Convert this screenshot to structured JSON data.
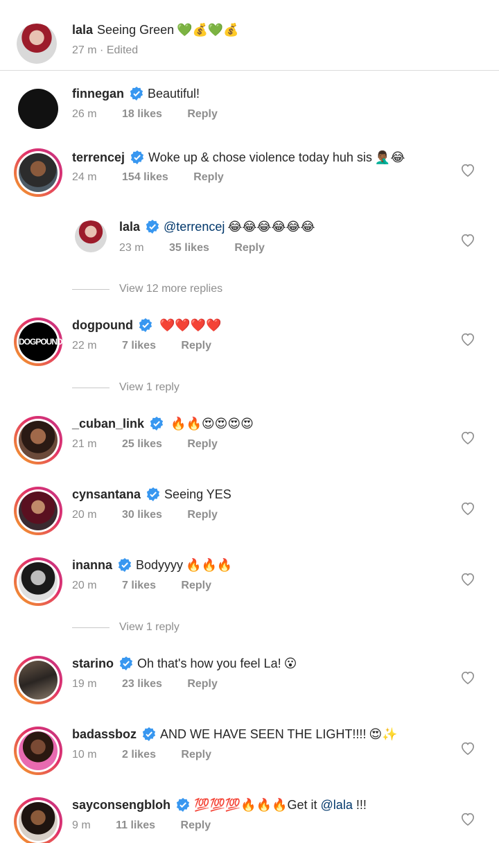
{
  "caption": {
    "username": "lala",
    "text": "Seeing Green",
    "emoji": "💚💰💚💰",
    "time": "27 m",
    "edited": "Edited"
  },
  "comments": [
    {
      "username": "finnegan",
      "text": "Beautiful!",
      "emoji": "",
      "time": "26 m",
      "likes": "18 likes",
      "reply": "Reply"
    },
    {
      "username": "terrencej",
      "text": "Woke up & chose violence today huh sis",
      "emoji": "🤦🏾‍♂️😂",
      "time": "24 m",
      "likes": "154 likes",
      "reply": "Reply"
    },
    {
      "username": "lala",
      "mention": "@terrencej",
      "emoji": "😂😂😂😂😂😂",
      "time": "23 m",
      "likes": "35 likes",
      "reply": "Reply"
    },
    {
      "view_replies": "View 12 more replies"
    },
    {
      "username": "dogpound",
      "text": "",
      "emoji": "❤️❤️❤️❤️",
      "time": "22 m",
      "likes": "7 likes",
      "reply": "Reply",
      "avatar_text": "DOGPOUND"
    },
    {
      "view_replies": "View 1 reply"
    },
    {
      "username": "_cuban_link",
      "text": "",
      "emoji": "🔥🔥😍😍😍😍",
      "time": "21 m",
      "likes": "25 likes",
      "reply": "Reply"
    },
    {
      "username": "cynsantana",
      "text": "Seeing YES",
      "emoji": "",
      "time": "20 m",
      "likes": "30 likes",
      "reply": "Reply"
    },
    {
      "username": "inanna",
      "text": "Bodyyyy",
      "emoji": "🔥🔥🔥",
      "time": "20 m",
      "likes": "7 likes",
      "reply": "Reply"
    },
    {
      "view_replies": "View 1 reply"
    },
    {
      "username": "starino",
      "text": "Oh that's how you feel La!",
      "emoji": "😮",
      "time": "19 m",
      "likes": "23 likes",
      "reply": "Reply"
    },
    {
      "username": "badassboz",
      "text": "AND WE HAVE SEEN THE LIGHT!!!!",
      "emoji": "😍✨",
      "time": "10 m",
      "likes": "2 likes",
      "reply": "Reply"
    },
    {
      "username": "sayconsengbloh",
      "emoji": "💯💯💯🔥🔥🔥",
      "text": "Get it",
      "mention": "@lala",
      "tail": "!!!",
      "time": "9 m",
      "likes": "11 likes",
      "reply": "Reply"
    }
  ],
  "colors": {
    "verified": "#3897f0",
    "mention": "#00376b",
    "muted": "#8e8e8e"
  }
}
